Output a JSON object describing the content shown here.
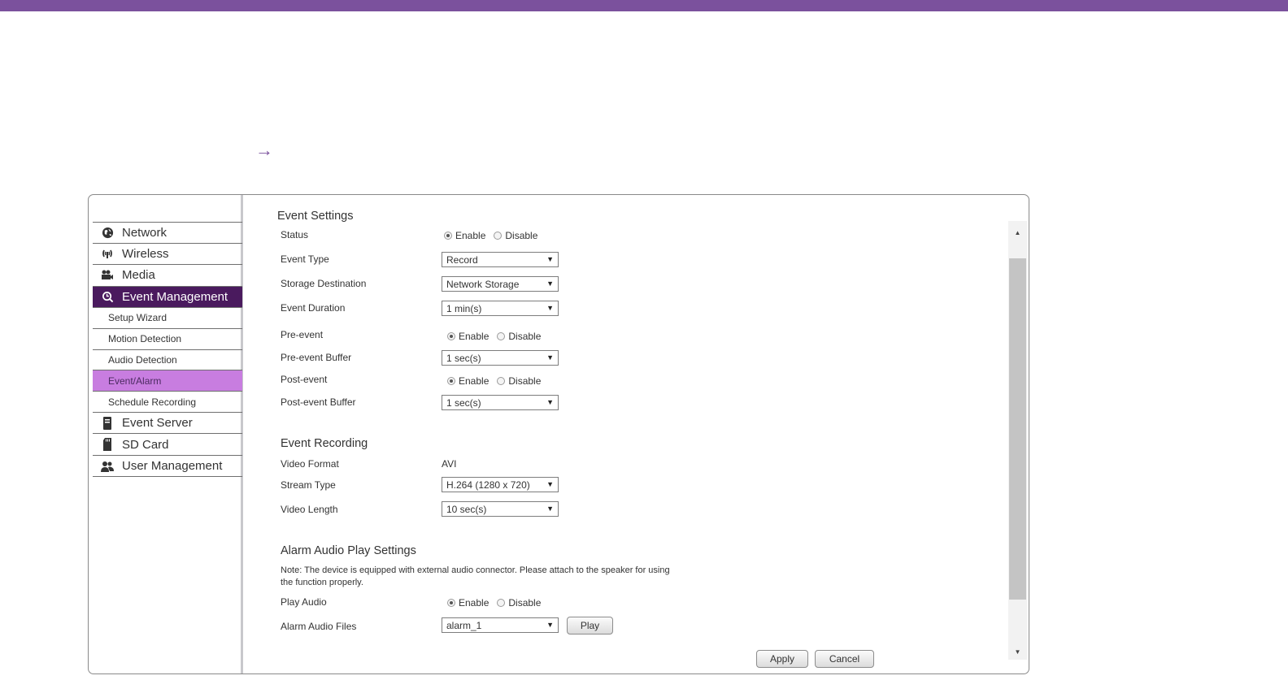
{
  "colors": {
    "accent": "#7b519d",
    "nav_active": "#4a1a5e",
    "sub_active": "#c87de0"
  },
  "banner": {
    "arrow": "→"
  },
  "sidebar": {
    "items": [
      {
        "label": "Network",
        "icon": "globe-icon"
      },
      {
        "label": "Wireless",
        "icon": "wireless-icon"
      },
      {
        "label": "Media",
        "icon": "media-icon"
      },
      {
        "label": "Event Management",
        "icon": "event-icon",
        "active": true
      }
    ],
    "sub_items": [
      {
        "label": "Setup Wizard"
      },
      {
        "label": "Motion Detection"
      },
      {
        "label": "Audio Detection"
      },
      {
        "label": "Event/Alarm",
        "active": true
      },
      {
        "label": "Schedule Recording"
      }
    ],
    "items_after": [
      {
        "label": "Event Server",
        "icon": "server-icon"
      },
      {
        "label": "SD Card",
        "icon": "sd-card-icon"
      },
      {
        "label": "User Management",
        "icon": "users-icon"
      }
    ]
  },
  "event_settings": {
    "title": "Event Settings",
    "status": {
      "label": "Status",
      "enable": "Enable",
      "disable": "Disable",
      "selected": "enable"
    },
    "event_type": {
      "label": "Event Type",
      "value": "Record"
    },
    "storage_destination": {
      "label": "Storage Destination",
      "value": "Network Storage"
    },
    "event_duration": {
      "label": "Event Duration",
      "value": "1 min(s)"
    },
    "pre_event": {
      "label": "Pre-event",
      "enable": "Enable",
      "disable": "Disable",
      "selected": "enable"
    },
    "pre_event_buffer": {
      "label": "Pre-event Buffer",
      "value": "1 sec(s)"
    },
    "post_event": {
      "label": "Post-event",
      "enable": "Enable",
      "disable": "Disable",
      "selected": "enable"
    },
    "post_event_buffer": {
      "label": "Post-event Buffer",
      "value": "1 sec(s)"
    }
  },
  "event_recording": {
    "title": "Event Recording",
    "video_format": {
      "label": "Video Format",
      "value": "AVI"
    },
    "stream_type": {
      "label": "Stream Type",
      "value": "H.264 (1280 x 720)"
    },
    "video_length": {
      "label": "Video Length",
      "value": "10 sec(s)"
    }
  },
  "alarm_audio": {
    "title": "Alarm Audio Play Settings",
    "note_line1": "Note: The device is equipped with external audio connector. Please attach to the speaker for using",
    "note_line2": "the function properly.",
    "play_audio": {
      "label": "Play Audio",
      "enable": "Enable",
      "disable": "Disable",
      "selected": "enable"
    },
    "alarm_audio_files": {
      "label": "Alarm Audio Files",
      "value": "alarm_1"
    },
    "play_button": "Play"
  },
  "footer": {
    "apply": "Apply",
    "cancel": "Cancel"
  }
}
